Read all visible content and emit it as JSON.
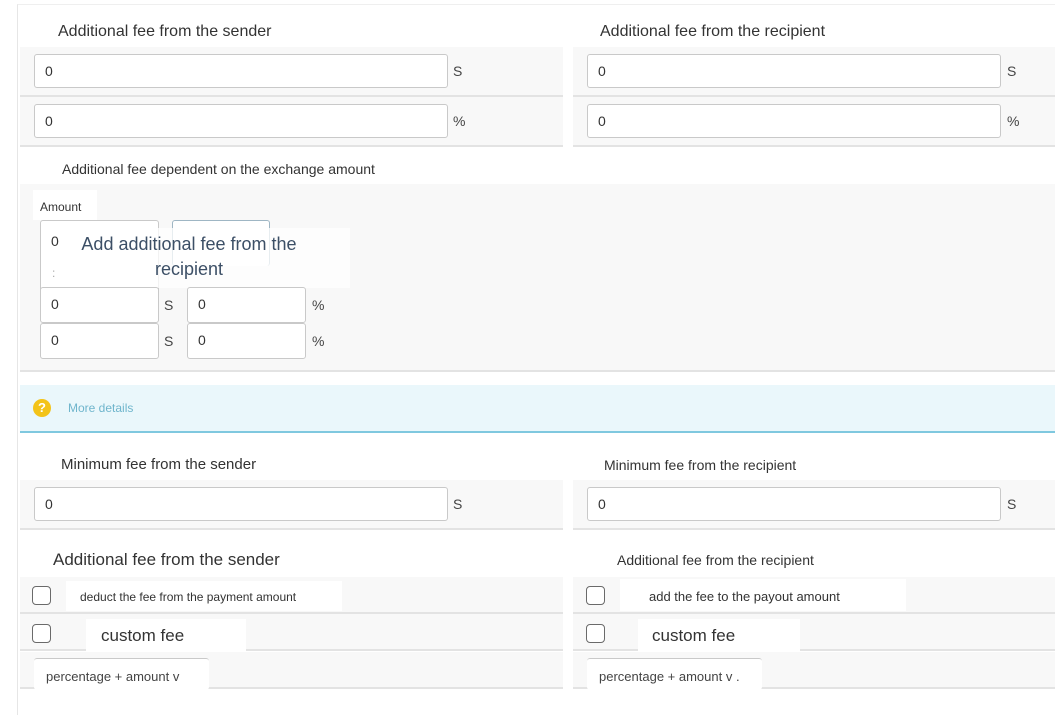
{
  "sender_additional_fee": {
    "title": "Additional fee from the sender",
    "fixed": {
      "value": "0",
      "unit": "S"
    },
    "percent": {
      "value": "0",
      "unit": "%"
    }
  },
  "recipient_additional_fee": {
    "title": "Additional fee from the recipient",
    "fixed": {
      "value": "0",
      "unit": "S"
    },
    "percent": {
      "value": "0",
      "unit": "%"
    }
  },
  "dependent_fee": {
    "title": "Additional fee dependent on the exchange amount",
    "amount_label": "Amount",
    "amount_first_value": "0",
    "tooltip": "Add additional fee from the recipient",
    "rows": [
      {
        "amount": "0",
        "amount_unit": "S",
        "fee": "0",
        "fee_unit": "%"
      },
      {
        "amount": "0",
        "amount_unit": "S",
        "fee": "0",
        "fee_unit": "%"
      }
    ]
  },
  "info": {
    "icon": "question-icon",
    "link_label": "More details"
  },
  "sender_min_fee": {
    "title": "Minimum fee from the sender",
    "value": "0",
    "unit": "S"
  },
  "recipient_min_fee": {
    "title": "Minimum fee from the recipient",
    "value": "0",
    "unit": "S"
  },
  "sender_options": {
    "title": "Additional fee from the sender",
    "deduct_label": "deduct the fee from the payment amount",
    "custom_label": "custom fee",
    "select_value": "percentage + amount v"
  },
  "recipient_options": {
    "title": "Additional fee from the recipient",
    "add_label": "add the fee to the payout amount",
    "custom_label": "custom fee",
    "select_value": "percentage + amount v ."
  },
  "colors": {
    "info_bg": "#eaf7fb",
    "info_border": "#7fc8df",
    "help_icon": "#f3c318",
    "link": "#6fb5cc"
  }
}
